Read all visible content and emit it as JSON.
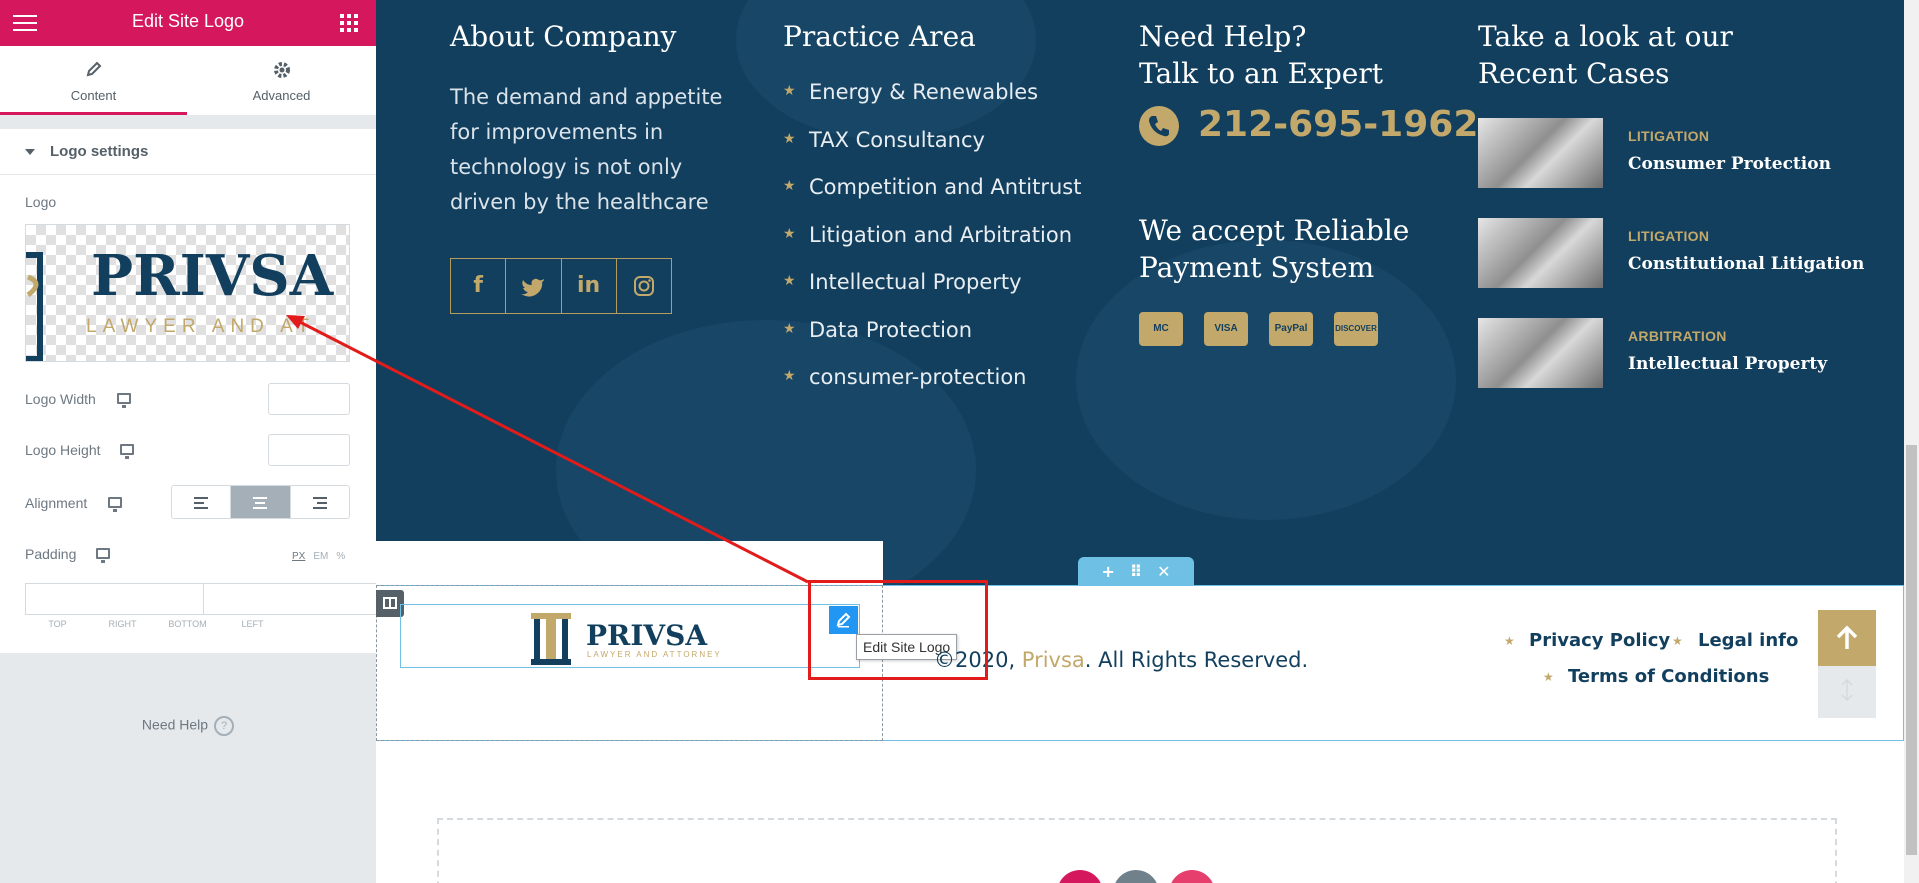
{
  "panel": {
    "title": "Edit Site Logo",
    "menu_icon": "hamburger-icon",
    "apps_icon": "grid-icon",
    "tabs": [
      {
        "label": "Content",
        "icon": "pencil-icon",
        "active": true
      },
      {
        "label": "Advanced",
        "icon": "gear-icon",
        "active": false
      }
    ],
    "section_title": "Logo settings",
    "logo_label": "Logo",
    "logo_width_label": "Logo Width",
    "logo_height_label": "Logo Height",
    "alignment_label": "Alignment",
    "padding_label": "Padding",
    "units": [
      "PX",
      "EM",
      "%"
    ],
    "padding_fields": [
      "TOP",
      "RIGHT",
      "BOTTOM",
      "LEFT"
    ],
    "need_help": "Need Help",
    "collapse_icon": "chevron-left-icon"
  },
  "logo": {
    "name": "PRIVSA",
    "tagline": "LAWYER AND ATTORNEY",
    "preview_tagline": "LAWYER AND AT"
  },
  "footer": {
    "about": {
      "heading": "About Company",
      "lines": [
        "The demand and appetite",
        "for improvements in",
        "technology is not only",
        "driven by the healthcare"
      ],
      "social": [
        "f",
        "t",
        "in",
        "ig"
      ]
    },
    "practice": {
      "heading": "Practice Area",
      "items": [
        "Energy & Renewables",
        "TAX Consultancy",
        "Competition and Antitrust",
        "Litigation and Arbitration",
        "Intellectual Property",
        "Data Protection",
        "consumer-protection"
      ]
    },
    "help": {
      "heading_line1": "Need Help?",
      "heading_line2": "Talk to an Expert",
      "phone": "212-695-1962",
      "payment_line1": "We accept Reliable",
      "payment_line2": "Payment System",
      "cards": [
        "MC",
        "VISA",
        "PayPal",
        "DISCOVER"
      ]
    },
    "cases": {
      "heading_line1": "Take a look at our",
      "heading_line2": "Recent Cases",
      "items": [
        {
          "category": "LITIGATION",
          "name": "Consumer Protection"
        },
        {
          "category": "LITIGATION",
          "name": "Constitutional Litigation"
        },
        {
          "category": "ARBITRATION",
          "name": "Intellectual Property"
        }
      ]
    }
  },
  "bottom": {
    "copyright_prefix": "©2020, ",
    "brand": "Privsa",
    "copyright_suffix": ". All Rights Reserved.",
    "links": [
      "Privacy Policy",
      "Legal info",
      "Terms of Conditions"
    ],
    "tooltip": "Edit Site Logo",
    "handle_add": "+",
    "handle_move": "⠿",
    "handle_close": "✕"
  },
  "colors": {
    "brand_pink": "#d5175e",
    "footer_navy": "#123f5e",
    "gold": "#c3a86b",
    "editor_blue": "#6ec1e4",
    "annotation_red": "#e21b1b"
  }
}
